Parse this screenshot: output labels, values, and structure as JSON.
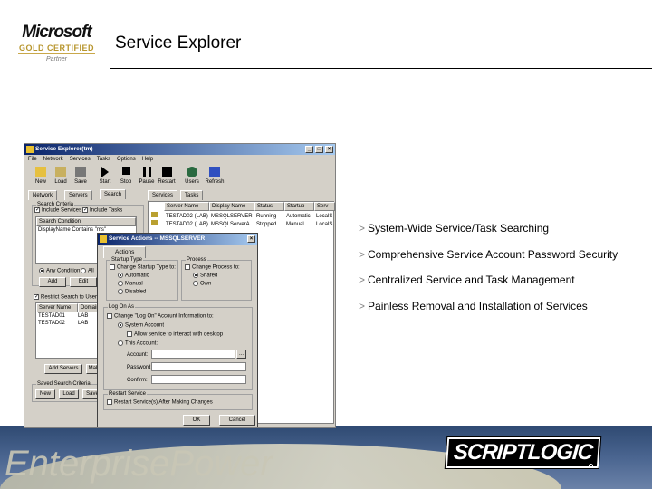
{
  "slide": {
    "title": "Service Explorer",
    "logo_text": {
      "brand": "Microsoft",
      "level": "GOLD CERTIFIED",
      "tier": "Partner"
    },
    "bullet_marker": ">",
    "bullets": [
      "System-Wide Service/Task Searching",
      "Comprehensive Service Account Password Security",
      "Centralized Service and Task Management",
      "Painless Removal and Installation of Services"
    ],
    "footer_logo": "SCRIPTLOGIC",
    "footer_watermark": "EnterprisePower"
  },
  "app": {
    "title": "Service Explorer(tm)",
    "menu": [
      "File",
      "Network",
      "Services",
      "Tasks",
      "Options",
      "Help"
    ],
    "toolbar": [
      "New",
      "Load",
      "Save",
      "Start",
      "Stop",
      "Pause",
      "Restart",
      "Users",
      "Refresh"
    ],
    "left_tabs": [
      "Network",
      "Servers",
      "Search"
    ],
    "right_tabs": [
      "Services",
      "Tasks"
    ],
    "search_criteria_label": "Search Criteria",
    "include_services": "Include Services",
    "include_tasks": "Include Tasks",
    "search_condition_header": "Search Condition",
    "search_condition_row": "DisplayName Contains \"ms\"",
    "any_condition": "Any Condition",
    "all_label": "All",
    "add_button": "Add",
    "edit_button": "Edit",
    "restrict_label": "Restrict Search to Userd",
    "server_headers": [
      "Server Name",
      "Domain N"
    ],
    "servers": [
      [
        "TESTAD01",
        "LAB"
      ],
      [
        "TESTAD02",
        "LAB"
      ]
    ],
    "add_servers_button": "Add Servers",
    "make_button": "Make",
    "saved_search_label": "Saved Search Criteria",
    "saved_buttons": [
      "New",
      "Load",
      "Save"
    ],
    "service_headers": [
      "Server Name",
      "Display Name",
      "Status",
      "Startup",
      "Serv"
    ],
    "services": [
      [
        "TESTAD02 (LAB)",
        "MSSQLSERVER",
        "Running",
        "Automatic",
        "LocalS"
      ],
      [
        "TESTAD02 (LAB)",
        "MSSQLServerA...",
        "Stopped",
        "Manual",
        "LocalS"
      ]
    ]
  },
  "dialog": {
    "title": "Service Actions -- MSSQLSERVER",
    "tab": "Actions",
    "startup_group": "Startup Type",
    "change_startup": "Change Startup Type to:",
    "startup_options": [
      "Automatic",
      "Manual",
      "Disabled"
    ],
    "process_group": "Process",
    "change_process": "Change Process to:",
    "process_options": [
      "Shared",
      "Own"
    ],
    "logon_group": "Log On As",
    "change_logon": "Change \"Log On\" Account Information to:",
    "system_account": "System Account",
    "allow_interact": "Allow service to interact with desktop",
    "this_account": "This Account:",
    "account_label": "Account:",
    "password_label": "Password:",
    "confirm_label": "Confirm:",
    "browse_button": "...",
    "restart_group": "Restart Service",
    "restart_check": "Restart Service(s) After Making Changes",
    "ok": "OK",
    "cancel": "Cancel"
  }
}
